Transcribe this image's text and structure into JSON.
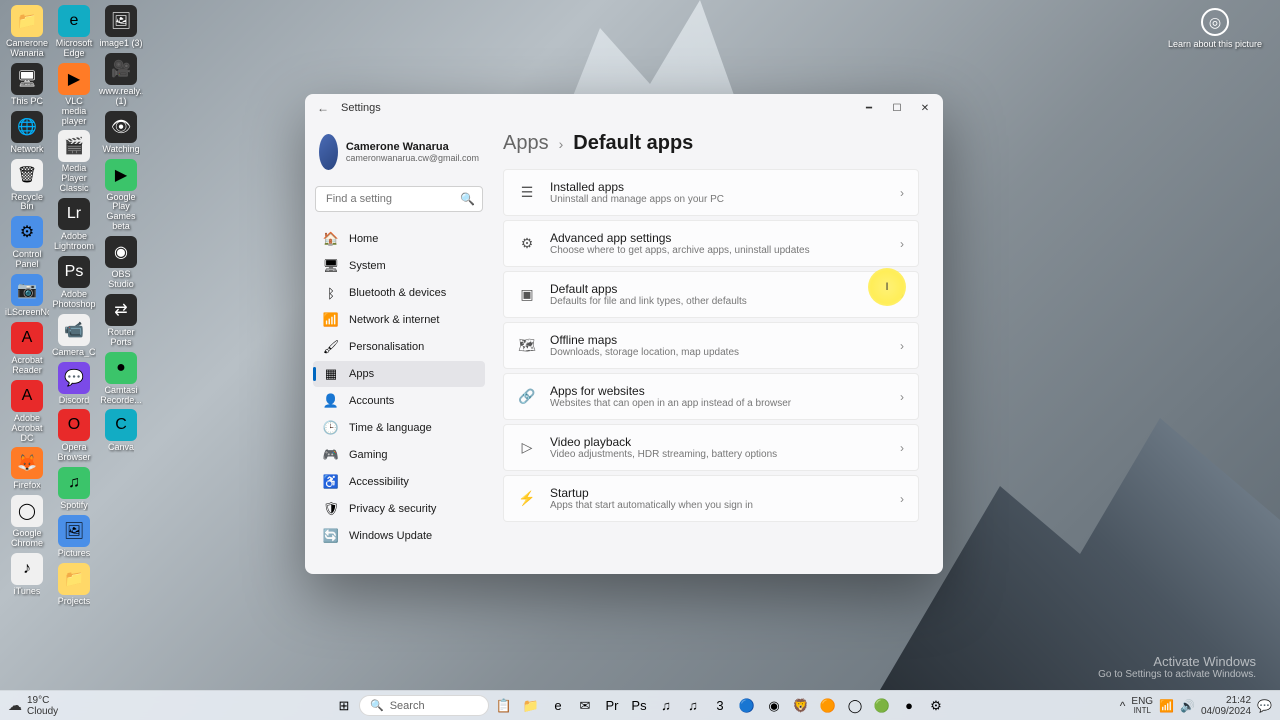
{
  "desktop_icons": [
    [
      {
        "label": "Camerone Wanaria",
        "color": "c-folder",
        "glyph": "📁"
      },
      {
        "label": "This PC",
        "color": "c-dark",
        "glyph": "🖥"
      },
      {
        "label": "Network",
        "color": "c-dark",
        "glyph": "🌐"
      },
      {
        "label": "Recycle Bin",
        "color": "c-white",
        "glyph": "🗑"
      },
      {
        "label": "Control Panel",
        "color": "c-blue",
        "glyph": "⚙"
      },
      {
        "label": "iLScreenNo...",
        "color": "c-blue",
        "glyph": "📷"
      },
      {
        "label": "Acrobat Reader",
        "color": "c-red",
        "glyph": "A"
      },
      {
        "label": "Adobe Acrobat DC",
        "color": "c-red",
        "glyph": "A"
      },
      {
        "label": "Firefox",
        "color": "c-orange",
        "glyph": "🦊"
      },
      {
        "label": "Google Chrome",
        "color": "c-white",
        "glyph": "◯"
      },
      {
        "label": "iTunes",
        "color": "c-white",
        "glyph": "♪"
      }
    ],
    [
      {
        "label": "Microsoft Edge",
        "color": "c-teal",
        "glyph": "e"
      },
      {
        "label": "VLC media player",
        "color": "c-orange",
        "glyph": "▶"
      },
      {
        "label": "Media Player Classic",
        "color": "c-white",
        "glyph": "🎬"
      },
      {
        "label": "Adobe Lightroom",
        "color": "c-dark",
        "glyph": "Lr"
      },
      {
        "label": "Adobe Photoshop",
        "color": "c-dark",
        "glyph": "Ps"
      },
      {
        "label": "Camera_C...",
        "color": "c-white",
        "glyph": "📹"
      },
      {
        "label": "Discord",
        "color": "c-purple",
        "glyph": "💬"
      },
      {
        "label": "Opera Browser",
        "color": "c-red",
        "glyph": "O"
      },
      {
        "label": "Spotify",
        "color": "c-green",
        "glyph": "♫"
      },
      {
        "label": "Pictures",
        "color": "c-blue",
        "glyph": "🖼"
      },
      {
        "label": "Projects",
        "color": "c-folder",
        "glyph": "📁"
      }
    ],
    [
      {
        "label": "image1 (3)",
        "color": "c-dark",
        "glyph": "🖼"
      },
      {
        "label": "www.realy...(1)",
        "color": "c-dark",
        "glyph": "🎥"
      },
      {
        "label": "Watching",
        "color": "c-dark",
        "glyph": "👁"
      },
      {
        "label": "Google Play Games beta",
        "color": "c-green",
        "glyph": "▶"
      },
      {
        "label": "OBS Studio",
        "color": "c-dark",
        "glyph": "◉"
      },
      {
        "label": "Router Ports",
        "color": "c-dark",
        "glyph": "⇄"
      },
      {
        "label": "Camtasi Recorde...",
        "color": "c-green",
        "glyph": "●"
      },
      {
        "label": "Canva",
        "color": "c-teal",
        "glyph": "C"
      }
    ]
  ],
  "top_right_badge": {
    "label": "Learn about this picture"
  },
  "window": {
    "title": "Settings",
    "user": {
      "name": "Camerone Wanarua",
      "email": "cameronwanarua.cw@gmail.com"
    },
    "search_placeholder": "Find a setting",
    "nav": [
      {
        "icon": "🏠",
        "label": "Home"
      },
      {
        "icon": "🖥",
        "label": "System"
      },
      {
        "icon": "ᛒ",
        "label": "Bluetooth & devices"
      },
      {
        "icon": "📶",
        "label": "Network & internet"
      },
      {
        "icon": "🖌",
        "label": "Personalisation"
      },
      {
        "icon": "▦",
        "label": "Apps",
        "active": true
      },
      {
        "icon": "👤",
        "label": "Accounts"
      },
      {
        "icon": "🕒",
        "label": "Time & language"
      },
      {
        "icon": "🎮",
        "label": "Gaming"
      },
      {
        "icon": "♿",
        "label": "Accessibility"
      },
      {
        "icon": "🛡",
        "label": "Privacy & security"
      },
      {
        "icon": "🔄",
        "label": "Windows Update"
      }
    ],
    "breadcrumb": {
      "a": "Apps",
      "b": "Default apps"
    },
    "cards": [
      {
        "icon": "☰",
        "title": "Installed apps",
        "desc": "Uninstall and manage apps on your PC"
      },
      {
        "icon": "⚙",
        "title": "Advanced app settings",
        "desc": "Choose where to get apps, archive apps, uninstall updates"
      },
      {
        "icon": "▣",
        "title": "Default apps",
        "desc": "Defaults for file and link types, other defaults"
      },
      {
        "icon": "🗺",
        "title": "Offline maps",
        "desc": "Downloads, storage location, map updates"
      },
      {
        "icon": "🔗",
        "title": "Apps for websites",
        "desc": "Websites that can open in an app instead of a browser"
      },
      {
        "icon": "▷",
        "title": "Video playback",
        "desc": "Video adjustments, HDR streaming, battery options"
      },
      {
        "icon": "⚡",
        "title": "Startup",
        "desc": "Apps that start automatically when you sign in"
      }
    ]
  },
  "activate": {
    "line1": "Activate Windows",
    "line2": "Go to Settings to activate Windows."
  },
  "taskbar": {
    "weather": {
      "temp": "19°C",
      "cond": "Cloudy"
    },
    "search": "Search",
    "center_icons": [
      "⊞",
      "🔍",
      "📋",
      "📁",
      "e",
      "✉",
      "Pr",
      "Ps",
      "♫",
      "♫",
      "3",
      "🔵",
      "◉",
      "🦁",
      "🟠",
      "◯",
      "🟢",
      "●",
      "⚙"
    ],
    "tray": {
      "lang1": "ENG",
      "lang2": "INTL",
      "time": "21:42",
      "date": "04/09/2024"
    }
  }
}
